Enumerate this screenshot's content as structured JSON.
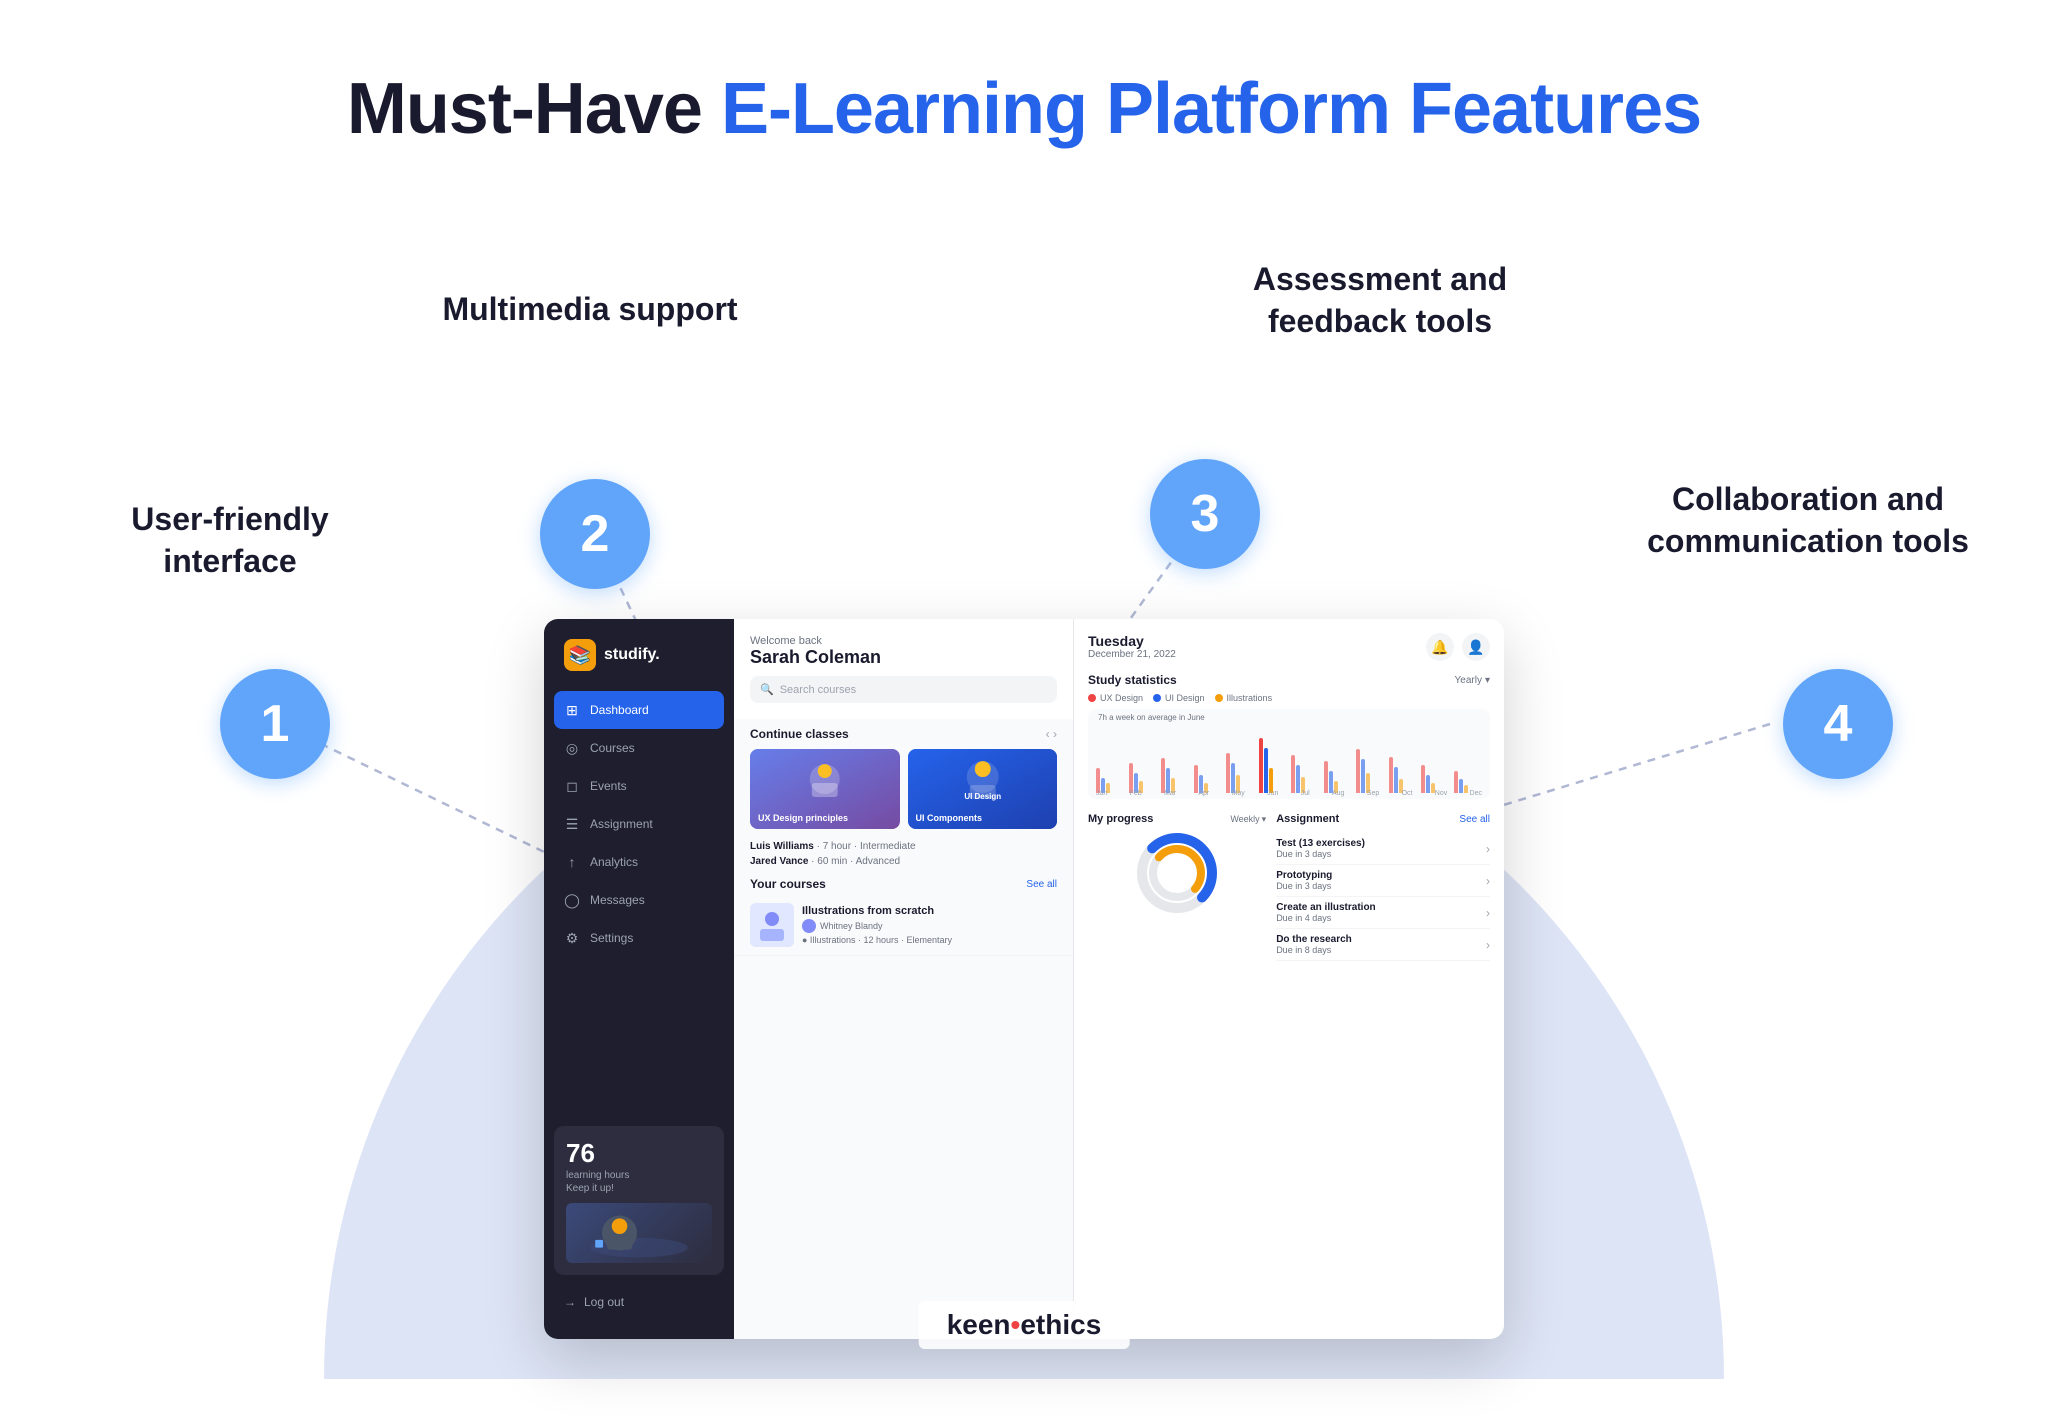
{
  "title": {
    "prefix": "Must-Have ",
    "highlight": "E-Learning Platform Features"
  },
  "features": [
    {
      "id": 1,
      "number": "1",
      "label": "User-friendly\ninterface"
    },
    {
      "id": 2,
      "number": "2",
      "label": "Multimedia support"
    },
    {
      "id": 3,
      "number": "3",
      "label": "Assessment and\nfeedback tools"
    },
    {
      "id": 4,
      "number": "4",
      "label": "Collaboration and\ncommunication tools"
    }
  ],
  "mockup": {
    "sidebar": {
      "logo": "studify.",
      "nav_items": [
        {
          "label": "Dashboard",
          "active": true
        },
        {
          "label": "Courses",
          "active": false
        },
        {
          "label": "Events",
          "active": false
        },
        {
          "label": "Assignment",
          "active": false
        },
        {
          "label": "Analytics",
          "active": false
        },
        {
          "label": "Messages",
          "active": false
        },
        {
          "label": "Settings",
          "active": false
        }
      ],
      "stats": {
        "number": "76",
        "label": "learning hours\nKeep it up!"
      },
      "footer": "Log out"
    },
    "main": {
      "welcome": {
        "greeting": "Welcome back",
        "name": "Sarah Coleman"
      },
      "search_placeholder": "Search courses",
      "continue_classes": {
        "title": "Continue classes",
        "cards": [
          {
            "label": "UX Design principles"
          },
          {
            "label": "UI Design"
          }
        ]
      },
      "courses": {
        "title": "Your courses",
        "see_all": "See all",
        "items": [
          {
            "name": "Illustrations from scratch",
            "author": "Whitney Blandy",
            "tag": "Illustrations",
            "hours": "12 hours",
            "level": "Elementary"
          }
        ]
      }
    },
    "right_panel": {
      "day": "Tuesday",
      "date": "December 21, 2022",
      "study_statistics": {
        "title": "Study statistics",
        "period": "Yearly",
        "legend": [
          {
            "label": "UX Design",
            "color": "#ef4444"
          },
          {
            "label": "UI Design",
            "color": "#2563eb"
          },
          {
            "label": "Illustrations",
            "color": "#f59e0b"
          }
        ],
        "chart_note": "7h a week on average in June",
        "months": [
          "Jan",
          "Feb",
          "Mar",
          "Apr",
          "May",
          "Jun",
          "Jul",
          "Aug",
          "Sep",
          "Oct",
          "Nov",
          "Dec"
        ]
      },
      "my_progress": {
        "title": "My progress",
        "period": "Weekly"
      },
      "assignment": {
        "title": "Assignment",
        "see_all": "See all",
        "items": [
          {
            "name": "Test (13 exercises)",
            "due": "Due in 3 days"
          },
          {
            "name": "Prototyping",
            "due": "Due in 3 days"
          },
          {
            "name": "Create an illustration",
            "due": "Due in 4 days"
          },
          {
            "name": "Do the research",
            "due": "Due in 8 days"
          }
        ]
      }
    }
  },
  "branding": {
    "name": "keen",
    "dot": "•",
    "suffix": "ethics"
  }
}
